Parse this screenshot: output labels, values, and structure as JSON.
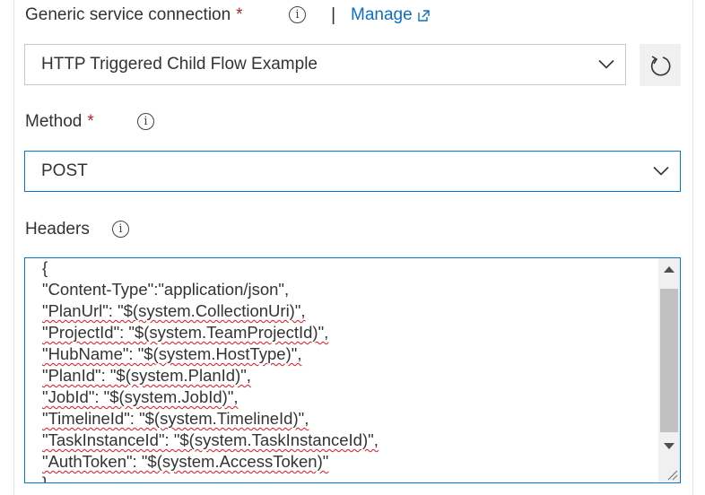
{
  "service_connection": {
    "label": "Generic service connection",
    "required_mark": "*",
    "separator": "|",
    "manage_label": "Manage",
    "selected_value": "HTTP Triggered Child Flow Example"
  },
  "method": {
    "label": "Method",
    "required_mark": "*",
    "selected_value": "POST"
  },
  "headers": {
    "label": "Headers",
    "lines": [
      "{",
      "\"Content-Type\":\"application/json\",",
      "\"PlanUrl\": \"$(system.CollectionUri)\",",
      "\"ProjectId\": \"$(system.TeamProjectId)\",",
      "\"HubName\": \"$(system.HostType)\",",
      "\"PlanId\": \"$(system.PlanId)\",",
      "\"JobId\": \"$(system.JobId)\",",
      "\"TimelineId\": \"$(system.TimelineId)\",",
      "\"TaskInstanceId\": \"$(system.TaskInstanceId)\",",
      "\"AuthToken\": \"$(system.AccessToken)\"",
      "}"
    ]
  },
  "colors": {
    "accent": "#0078d4",
    "link": "#106ebe",
    "required": "#a4262c",
    "spellcheck": "#e81123"
  }
}
